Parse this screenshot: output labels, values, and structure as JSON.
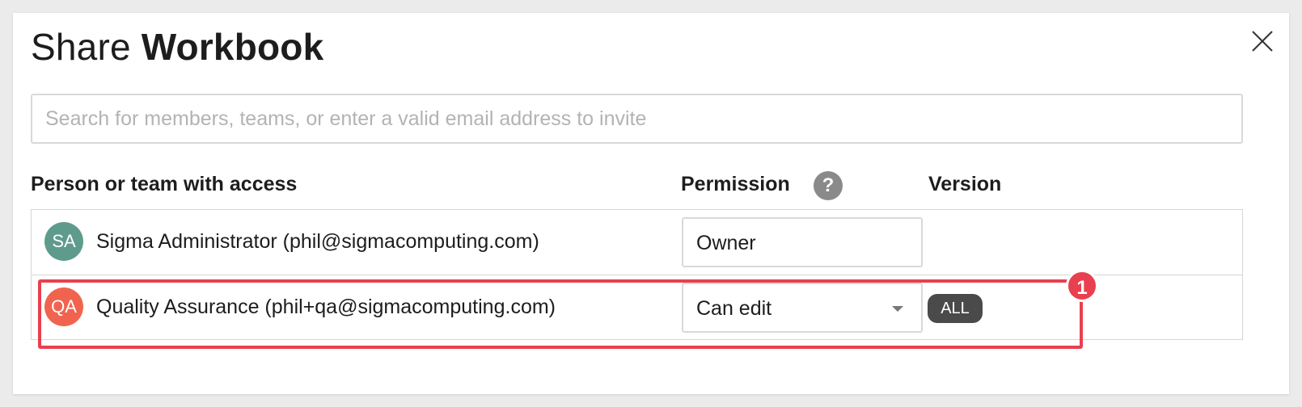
{
  "dialog": {
    "title_light": "Share",
    "title_bold": "Workbook",
    "close_icon": "close-icon"
  },
  "search": {
    "placeholder": "Search for members, teams, or enter a valid email address to invite",
    "value": ""
  },
  "table": {
    "headers": {
      "person": "Person or team with access",
      "permission": "Permission",
      "version": "Version"
    },
    "help_icon": "help-icon",
    "help_glyph": "?",
    "rows": [
      {
        "initials": "SA",
        "avatar_color": "#5f9b8c",
        "name": "Sigma Administrator (phil@sigmacomputing.com)",
        "permission": "Owner",
        "has_dropdown": false,
        "version": ""
      },
      {
        "initials": "QA",
        "avatar_color": "#f0644f",
        "name": "Quality Assurance (phil+qa@sigmacomputing.com)",
        "permission": "Can edit",
        "has_dropdown": true,
        "version": "ALL"
      }
    ]
  },
  "annotation": {
    "marker_label": "1",
    "color": "#e8404f"
  },
  "colors": {
    "badge_bg": "#4a4a4a",
    "badge_text": "#ffffff",
    "help_bg": "#8a8a8a"
  }
}
